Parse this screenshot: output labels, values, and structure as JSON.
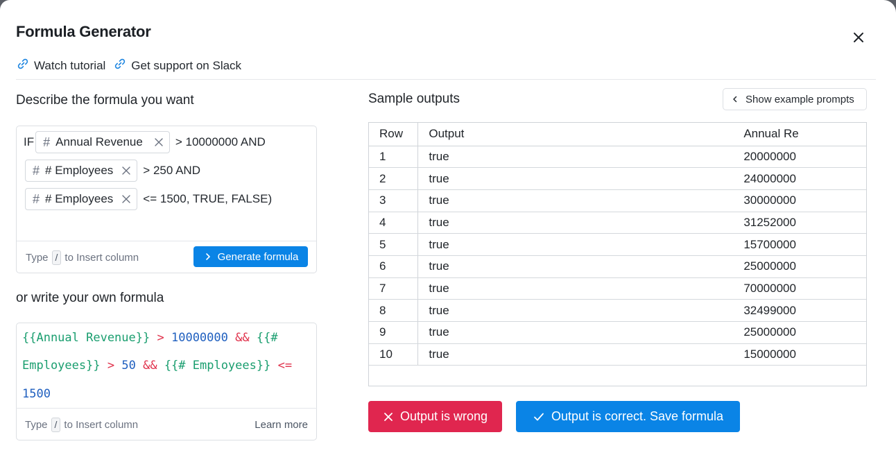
{
  "dialog": {
    "title": "Formula Generator",
    "links": [
      {
        "label": "Watch tutorial",
        "icon": "link-icon"
      },
      {
        "label": "Get support on Slack",
        "icon": "link-icon"
      }
    ]
  },
  "describe": {
    "heading": "Describe the formula you want",
    "line1_prefix": "IF",
    "line1_chip": "Annual Revenue",
    "line1_suffix": "> 10000000 AND",
    "line2_chip": "# Employees",
    "line2_suffix": "> 250 AND",
    "line3_chip": "# Employees",
    "line3_suffix": "<= 1500, TRUE, FALSE)",
    "hint_before": "Type",
    "hint_key": "/",
    "hint_after": "to Insert column",
    "generate_label": "Generate formula"
  },
  "own": {
    "heading": "or write your own formula",
    "code": {
      "t1": "{{Annual Revenue}}",
      "t2": ">",
      "t3": "10000000",
      "t4": "&&",
      "t5": "{{#",
      "t6": "Employees}}",
      "t7": ">",
      "t8": "50",
      "t9": "&&",
      "t10": "{{# Employees}}",
      "t11": "<=",
      "t12": "1500"
    },
    "hint_before": "Type",
    "hint_key": "/",
    "hint_after": "to Insert column",
    "learn_more": "Learn more"
  },
  "samples": {
    "heading": "Sample outputs",
    "show_prompts_label": "Show example prompts",
    "columns": [
      "Row",
      "Output",
      "Annual Re"
    ],
    "rows": [
      [
        "1",
        "true",
        "20000000"
      ],
      [
        "2",
        "true",
        "24000000"
      ],
      [
        "3",
        "true",
        "30000000"
      ],
      [
        "4",
        "true",
        "31252000"
      ],
      [
        "5",
        "true",
        "15700000"
      ],
      [
        "6",
        "true",
        "25000000"
      ],
      [
        "7",
        "true",
        "70000000"
      ],
      [
        "8",
        "true",
        "32499000"
      ],
      [
        "9",
        "true",
        "25000000"
      ],
      [
        "10",
        "true",
        "15000000"
      ]
    ]
  },
  "actions": {
    "wrong_label": "Output is wrong",
    "correct_label": "Output is correct. Save formula"
  },
  "colors": {
    "primary": "#0a84e6",
    "danger": "#e0264f",
    "code_variable": "#1a9e6f",
    "code_operator": "#e0314b",
    "code_number": "#1f5fbf"
  }
}
